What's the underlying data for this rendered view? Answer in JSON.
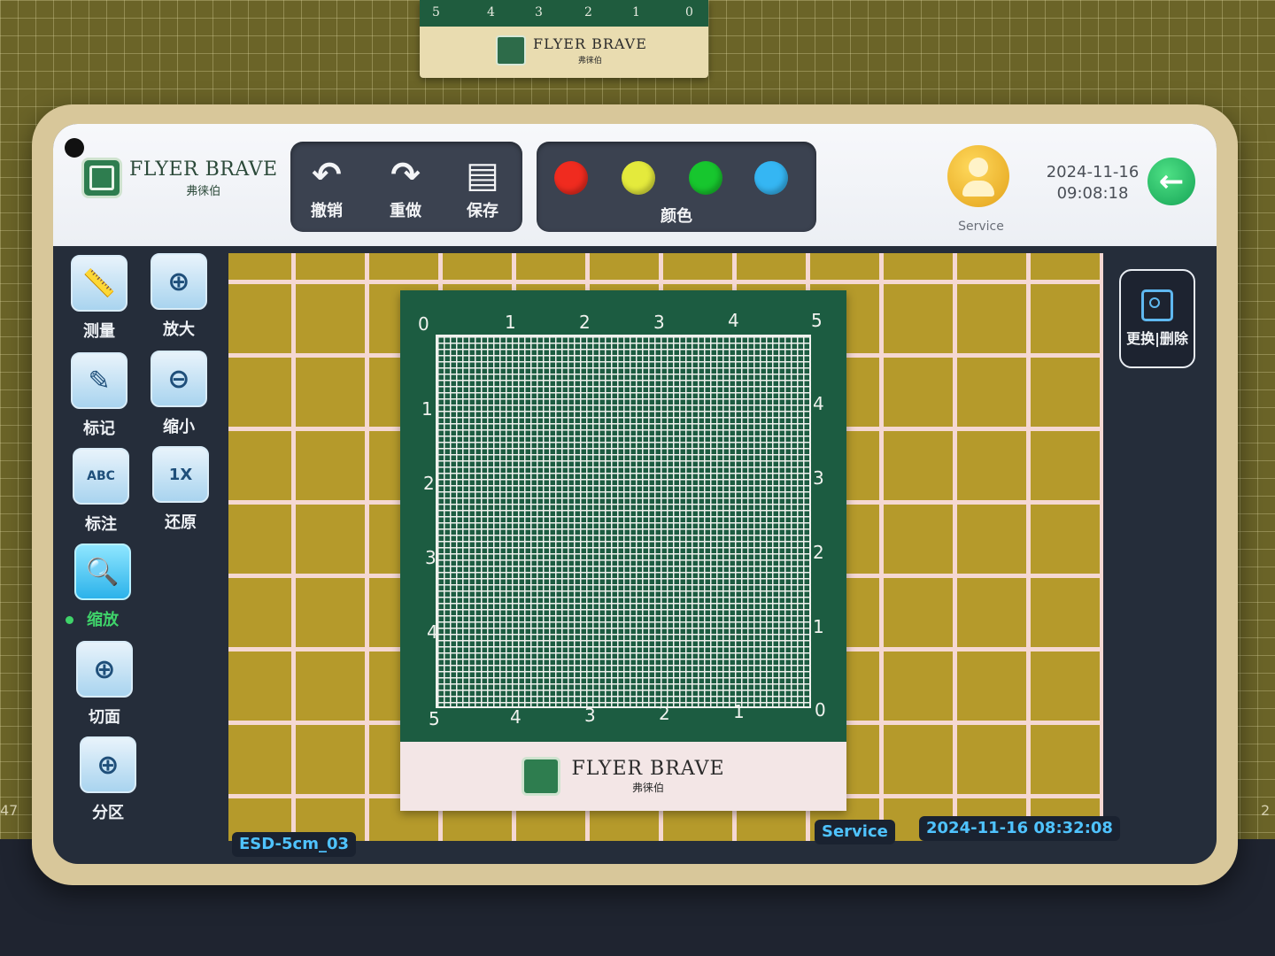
{
  "top_card": {
    "ruler_numbers": [
      "5",
      "4",
      "3",
      "2",
      "1",
      "0"
    ],
    "brand_name": "FLYER BRAVE",
    "brand_sub": "弗徕伯"
  },
  "mat": {
    "left_label": "47",
    "right_label": "2"
  },
  "header": {
    "brand_name": "FLYER BRAVE",
    "brand_sub": "弗徕伯",
    "edit_tools": [
      {
        "label": "撤销",
        "icon": "undo-icon"
      },
      {
        "label": "重做",
        "icon": "redo-icon"
      },
      {
        "label": "保存",
        "icon": "save-icon"
      }
    ],
    "colors": {
      "label": "颜色",
      "swatches": [
        "#f02b1f",
        "#e4ea3c",
        "#17c62e",
        "#35b6f3"
      ]
    },
    "service_label": "Service",
    "date": "2024-11-16",
    "time": "09:08:18",
    "back_icon": "arrow-left-icon"
  },
  "left_tools": [
    {
      "label": "测量",
      "icon": "ruler-icon"
    },
    {
      "label": "放大",
      "icon": "zoom-in-icon"
    },
    {
      "label": "标记",
      "icon": "pencil-icon"
    },
    {
      "label": "缩小",
      "icon": "zoom-out-icon"
    },
    {
      "label": "标注",
      "icon": "text-label-icon",
      "glyph": "ABC"
    },
    {
      "label": "还原",
      "icon": "zoom-reset-icon",
      "glyph": "1X"
    },
    {
      "label": "缩放",
      "icon": "zoom-icon",
      "active": true
    },
    {
      "label": "切面",
      "icon": "crosshair-circle-icon"
    },
    {
      "label": "分区",
      "icon": "quadrant-circle-icon"
    }
  ],
  "right_panel": {
    "replace_delete_label": "更换|删除",
    "icon": "image-swap-icon"
  },
  "card": {
    "top_numbers": [
      "0",
      "1",
      "2",
      "3",
      "4",
      "5"
    ],
    "left_numbers": [
      "1",
      "2",
      "3",
      "4",
      "5"
    ],
    "right_numbers": [
      "4",
      "3",
      "2",
      "1"
    ],
    "bottom_numbers": [
      "4",
      "3",
      "2",
      "1",
      "0"
    ],
    "brand_name": "FLYER BRAVE",
    "brand_sub": "弗徕伯"
  },
  "footer": {
    "file_name": "ESD-5cm_03",
    "service_tag": "Service",
    "timestamp": "2024-11-16 08:32:08"
  }
}
